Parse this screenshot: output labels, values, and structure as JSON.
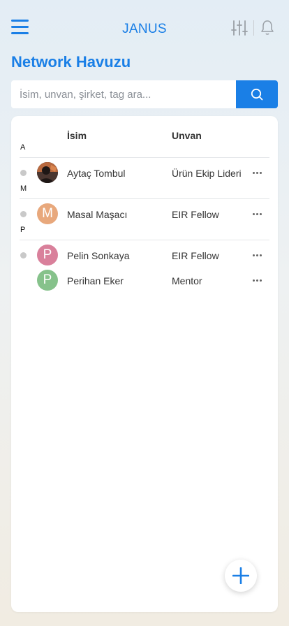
{
  "header": {
    "app_title": "JANUS"
  },
  "page": {
    "title": "Network Havuzu"
  },
  "search": {
    "placeholder": "İsim, unvan, şirket, tag ara..."
  },
  "table": {
    "columns": {
      "name": "İsim",
      "title": "Unvan"
    },
    "groups": [
      {
        "letter": "A",
        "people": [
          {
            "name": "Aytaç Tombul",
            "title": "Ürün Ekip Lideri",
            "avatar_type": "photo",
            "status": "offline"
          }
        ]
      },
      {
        "letter": "M",
        "people": [
          {
            "name": "Masal Maşacı",
            "title": "EIR Fellow",
            "avatar_letter": "M",
            "avatar_color": "#e8a87c",
            "status": "offline"
          }
        ]
      },
      {
        "letter": "P",
        "people": [
          {
            "name": "Pelin Sonkaya",
            "title": "EIR Fellow",
            "avatar_letter": "P",
            "avatar_color": "#d9809b",
            "status": "offline"
          },
          {
            "name": "Perihan Eker",
            "title": "Mentor",
            "avatar_letter": "P",
            "avatar_color": "#86c28b"
          }
        ]
      }
    ]
  },
  "colors": {
    "accent": "#1a7fe6",
    "status_offline": "#c9c9c9"
  },
  "icons": {
    "menu": "hamburger-menu-icon",
    "filter": "sliders-icon",
    "notifications": "bell-icon",
    "search": "search-icon",
    "more": "more-horizontal-icon",
    "add": "plus-icon"
  }
}
